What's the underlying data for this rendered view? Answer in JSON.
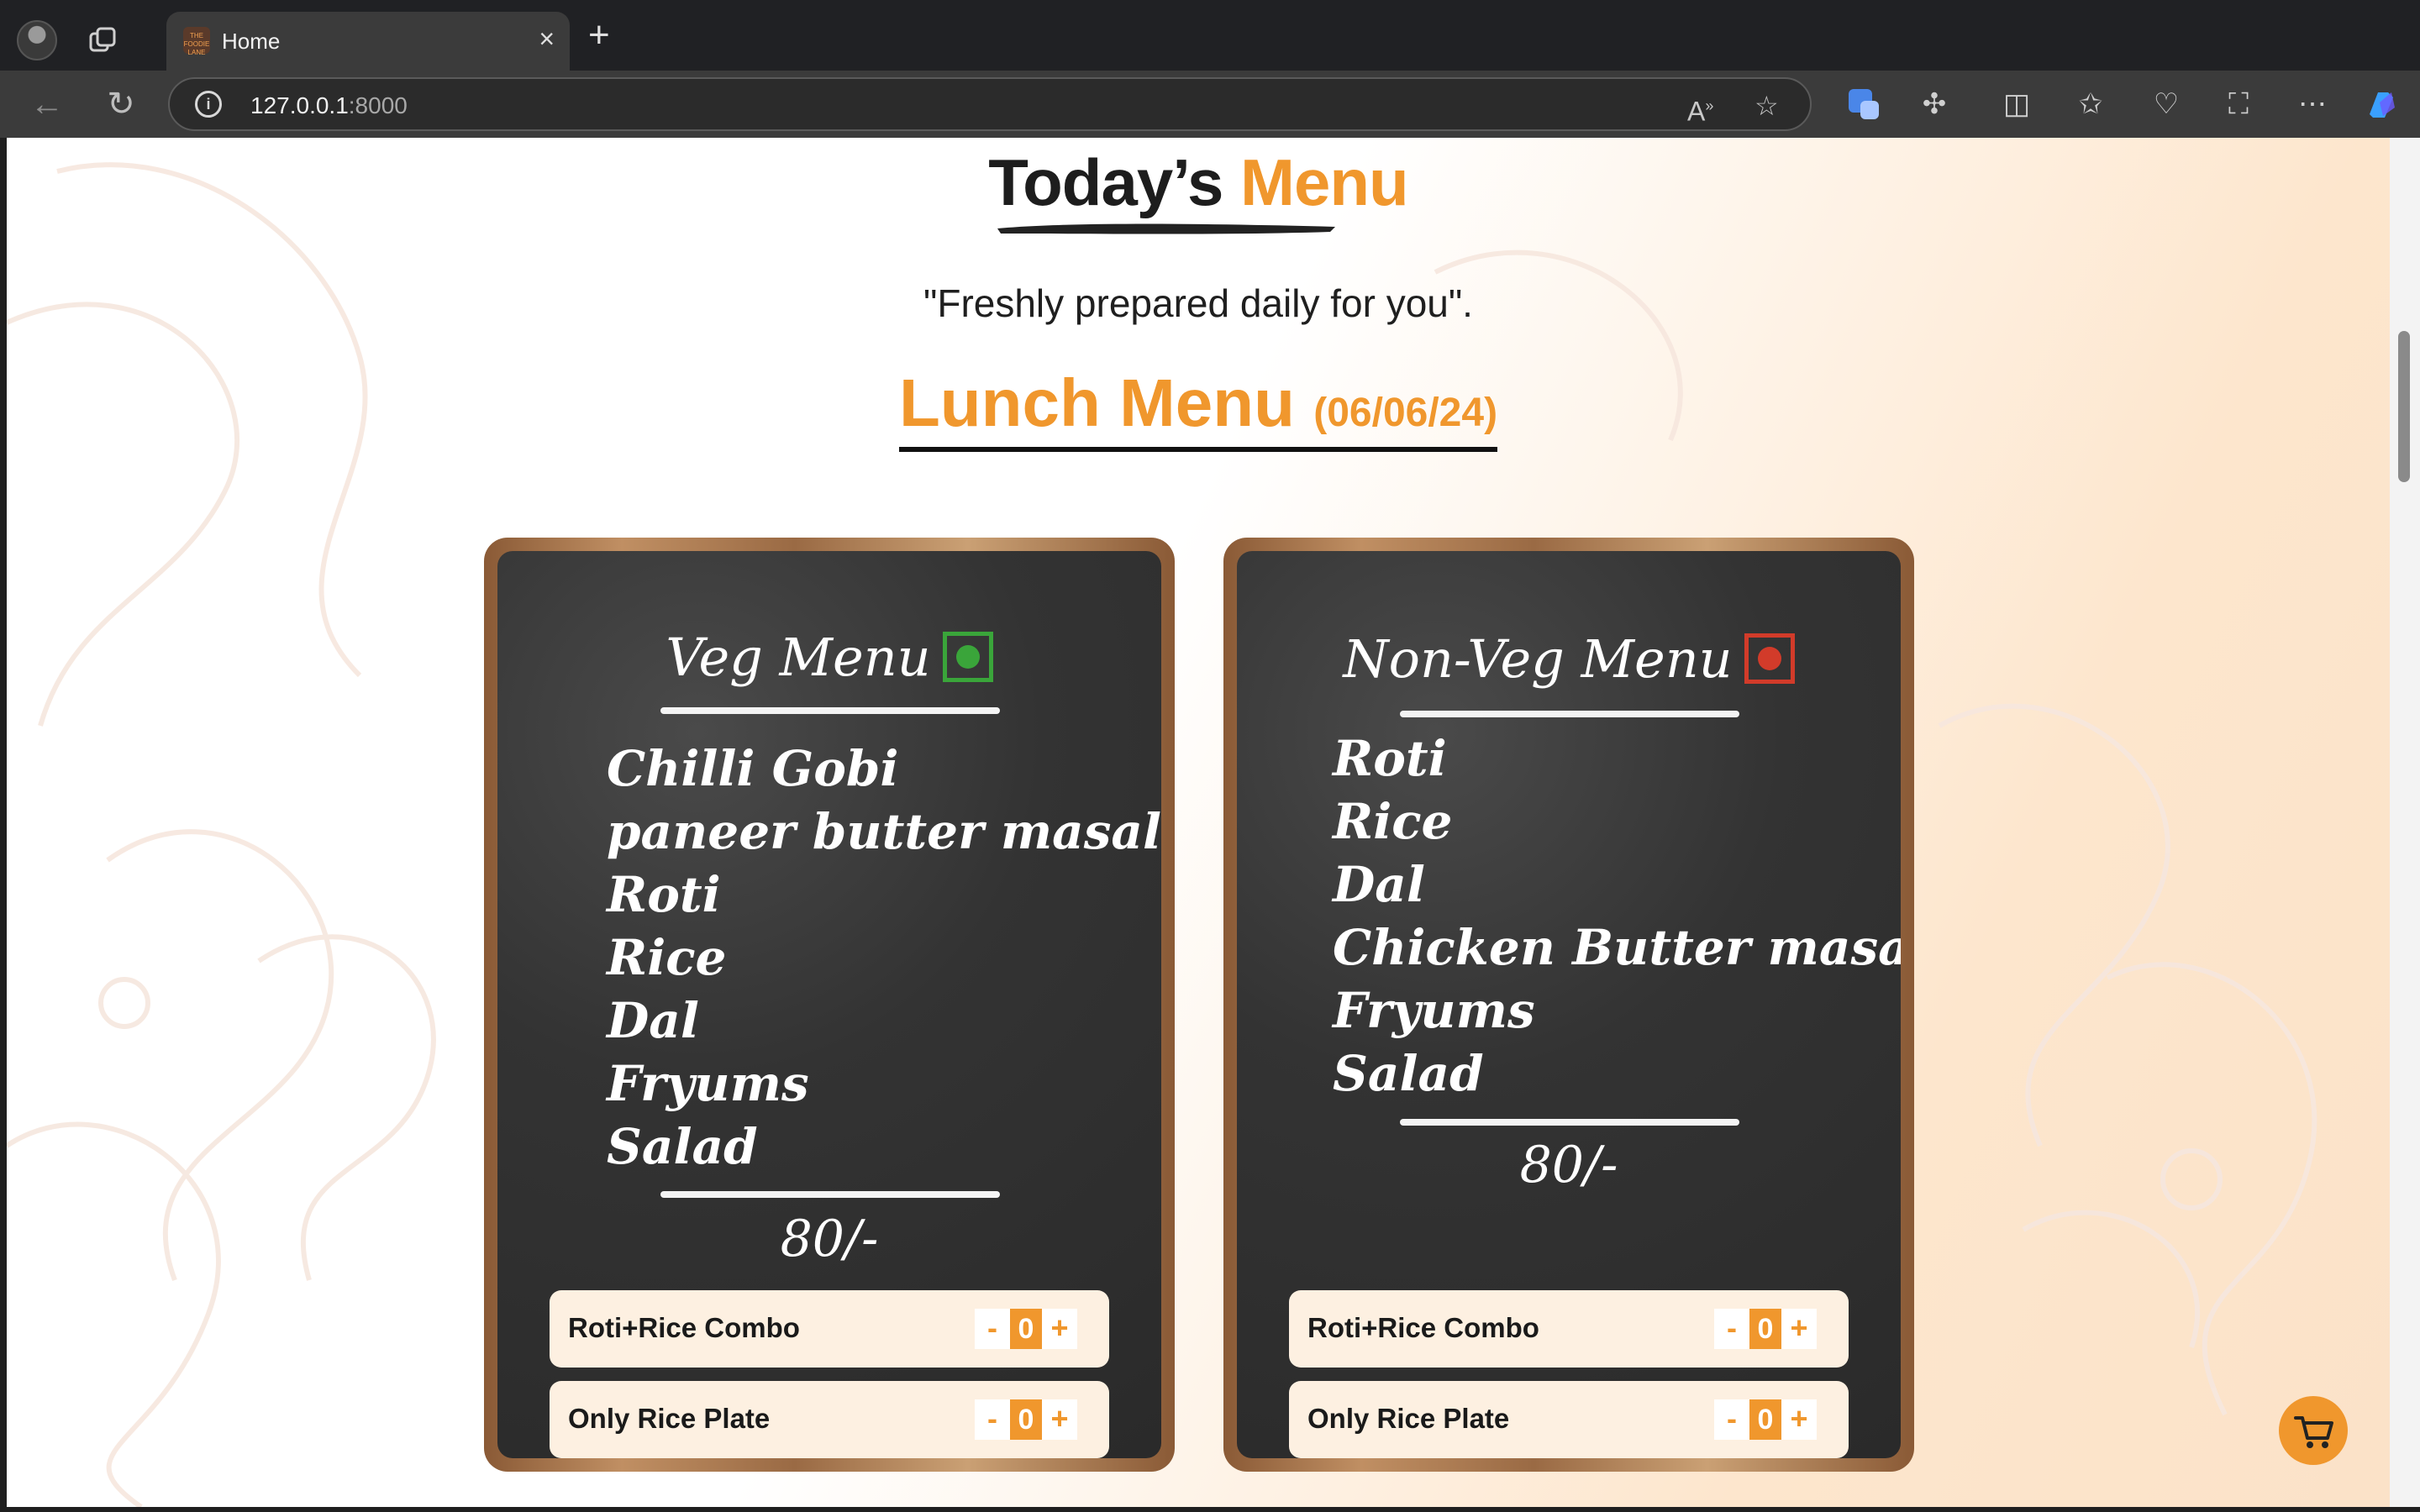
{
  "browser": {
    "tab_title": "Home",
    "tab_favicon_text": "THE FOODIE LANE",
    "url_host": "127.0.0.1",
    "url_port": ":8000"
  },
  "page": {
    "heading_main": "Today’s",
    "heading_accent": "Menu",
    "tagline": "\"Freshly prepared daily for you\".",
    "lunch_title": "Lunch Menu",
    "lunch_date": "(06/06/24)"
  },
  "veg": {
    "title": "Veg Menu",
    "items": [
      "Chilli Gobi",
      "paneer butter masala",
      "Roti",
      "Rice",
      "Dal",
      "Fryums",
      "Salad"
    ],
    "price": "80/-",
    "orders": [
      {
        "label": "Roti+Rice Combo",
        "minus": "-",
        "qty": "0",
        "plus": "+"
      },
      {
        "label": "Only Rice Plate",
        "minus": "-",
        "qty": "0",
        "plus": "+"
      }
    ]
  },
  "nonveg": {
    "title": "Non-Veg Menu",
    "items": [
      "Roti",
      "Rice",
      "Dal",
      "Chicken Butter masala",
      "Fryums",
      "Salad"
    ],
    "price": "80/-",
    "orders": [
      {
        "label": "Roti+Rice Combo",
        "minus": "-",
        "qty": "0",
        "plus": "+"
      },
      {
        "label": "Only Rice Plate",
        "minus": "-",
        "qty": "0",
        "plus": "+"
      }
    ]
  },
  "colors": {
    "accent": "#f0972d",
    "veg_mark": "#3aa53a",
    "nonveg_mark": "#d23b2a"
  }
}
